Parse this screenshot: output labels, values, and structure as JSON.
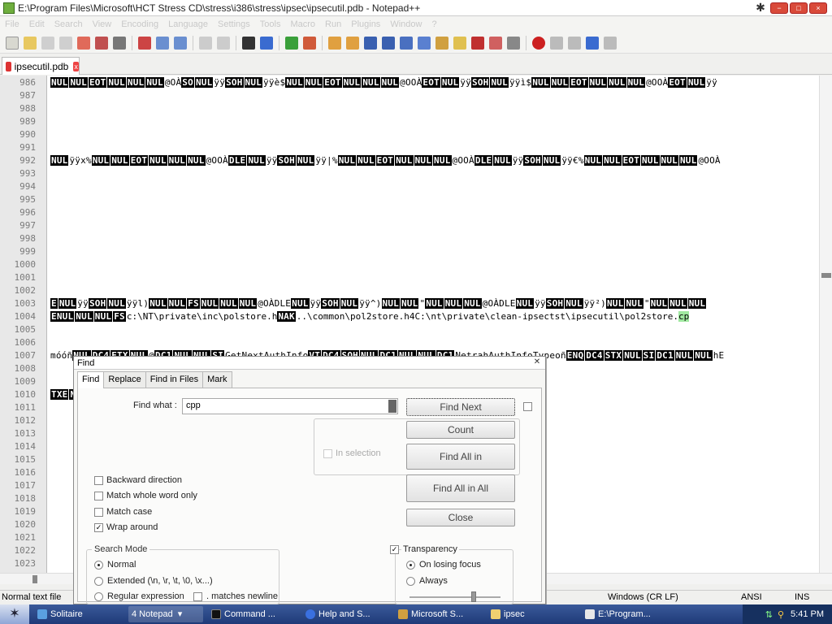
{
  "window": {
    "title": "E:\\Program Files\\Microsoft\\HCT Stress CD\\stress\\i386\\stress\\ipsec\\ipsecutil.pdb - Notepad++",
    "min_label": "−",
    "max_label": "□",
    "close_label": "×"
  },
  "menu": [
    "File",
    "Edit",
    "Search",
    "View",
    "Encoding",
    "Language",
    "Settings",
    "Tools",
    "Macro",
    "Run",
    "Plugins",
    "Window",
    "?"
  ],
  "tabs": [
    {
      "label": "ipsecutil.pdb",
      "close": "x"
    }
  ],
  "editor": {
    "line_numbers": [
      "986",
      "987",
      "988",
      "989",
      "990",
      "991",
      "992",
      "993",
      "994",
      "995",
      "996",
      "997",
      "998",
      "999",
      "1000",
      "1001",
      "1002",
      "1003",
      "1004",
      "1005",
      "1006",
      "1007",
      "1008",
      "1009",
      "1010",
      "1011",
      "1012",
      "1013",
      "1014",
      "1015",
      "1016",
      "1017",
      "1018",
      "1019",
      "1020",
      "1021",
      "1022",
      "1023"
    ],
    "line_986": "NUL NUL EOT NUL NUL NUL @ OÀ SO NUL ÿÿ SOH NUL ÿÿè$ NUL NUL EOT NUL NUL NUL @OOÀ EOT NUL ÿÿ SOH NUL ÿÿì$ NUL NUL EOT NUL NUL NUL @OOÀ EOT NUL ÿÿ",
    "line_992": "NUL ÿÿx% NUL NUL EOT NUL NUL NUL @OOÀ DLE NUL ÿÿ SOH NUL ÿÿ|% NUL NUL EOT NUL NUL NUL @OOÀ DLE NUL ÿÿ SOH NUL ÿÿ€% NUL NUL EOT NUL NUL NUL @OOÀ",
    "line_1003": "E NUL ÿÿ SOH NUL ÿÿl) NUL NUL FS NUL NUL NUL @O ÀDLE NUL ÿÿ SOH NUL ÿÿ^) NUL NUL \" NUL NUL NUL @O ÀDLE NUL ÿÿ SOH NUL ÿÿ²) NUL NUL \" NUL NUL NUL",
    "line_1004_pre": "ENUL NUL NUL FS",
    "line_1004_text": "c:\\NT\\private\\inc\\polstore.h",
    "line_1004_mid": "NAK",
    "line_1004_text2": "..\\common\\pol2store.h4C:\\nt\\private\\clean-ipsectst\\ipsecutil\\pol2store.",
    "line_1004_hl": "cp",
    "line_1007": "móóñ NUL DC4 ETX NUL @ DC1 NUL NUL SI GetNextAuthInfo VT DC4 SOH NUL DC1 NUL NUL DC1 NetrahAuthInfoTypeoñ ENQ DC4 STX NUL SI DC1 NUL NUL hE",
    "line_1010": "TXE NUL ETX NUL FF CC_MACPASCALñ ETX EOT ETX NUL EOT"
  },
  "find_dialog": {
    "title": "Find",
    "tabs": [
      "Find",
      "Replace",
      "Find in Files",
      "Mark"
    ],
    "find_what_label": "Find what :",
    "find_what_value": "cpp",
    "buttons": {
      "find_next": "Find Next",
      "count": "Count",
      "find_all_in": "Find All in",
      "find_all_in_all": "Find All in All",
      "close": "Close"
    },
    "in_selection": "In selection",
    "options": {
      "backward": "Backward direction",
      "whole_word": "Match whole word only",
      "match_case": "Match case",
      "wrap_around": "Wrap around",
      "wrap_around_checked": true
    },
    "search_mode": {
      "label": "Search Mode",
      "normal": "Normal",
      "extended": "Extended (\\n, \\r, \\t, \\0, \\x...)",
      "regex": "Regular expression",
      "matches_newline": ". matches newline",
      "selected": "normal"
    },
    "transparency": {
      "label": "Transparency",
      "checked": true,
      "on_losing_focus": "On losing focus",
      "always": "Always",
      "selected": "on_losing_focus",
      "level": 0.72
    }
  },
  "statusbar": {
    "filetype": "Normal text file",
    "eol": "Windows (CR LF)",
    "encoding": "ANSI",
    "mode": "INS"
  },
  "taskbar": {
    "items": [
      "Solitaire",
      "4 Notepad",
      "Command ...",
      "Help and S...",
      "Microsoft S...",
      "ipsec",
      "E:\\Program..."
    ],
    "time": "5:41 PM"
  }
}
